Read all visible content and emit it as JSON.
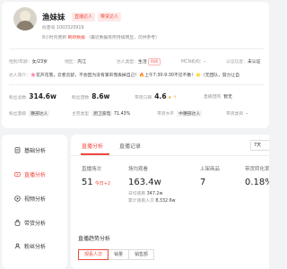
{
  "profile": {
    "name": "渔妹妹",
    "tags": [
      "直播达人",
      "带货达人"
    ],
    "meta_line": "抖音号 1003320919",
    "meta_line2_prefix": "8小时内更新",
    "meta_line2_link": "刷新数据",
    "meta_line2_suffix": "（最近数据有所持续明显，仅供参考）"
  },
  "info_row1": {
    "gender_label": "性别/年龄",
    "gender_value": "女/23岁",
    "region_label": "地区",
    "region_value": "内江",
    "type_label": "达人类型",
    "type_value": "生活",
    "type_pill": "时尚",
    "mcn_label": "MCN机构",
    "mcn_value": "-",
    "cert_label": "认证信息",
    "cert_value": "未认证"
  },
  "bio": {
    "label": "达人简介",
    "text": "🌸花开花落，云卷云舒，不会因为没有掌声而丢掉自己！🔥上午7:30-9:30不见不散！🌟（无团队，努力让自"
  },
  "stats_row1": {
    "fans_label": "粉丝总数",
    "fans_value": "314.6w",
    "fans_gain_label": "粉丝团数",
    "fans_gain_value": "8.6w",
    "score_label": "带货口碑",
    "score_value": "4.6",
    "score_star": "★",
    "score_rank": "↑",
    "level_label": "直播团购",
    "level_value": "暂无"
  },
  "stats_row2": {
    "level_label": "粉丝量级",
    "level_value": "腰部达人",
    "main_label": "主营类型",
    "main_value": "厨卫家电",
    "main_pct": "71.43%",
    "tier_label": "带货水平",
    "tier_value": "中腰部达人",
    "cat_label": "带货类目",
    "cat_value": "-"
  },
  "sidebar": {
    "items": [
      "基础分析",
      "直播分析",
      "视频分析",
      "带货分析",
      "粉丝分析"
    ]
  },
  "main": {
    "tabs": [
      "直播分析",
      "直播记录"
    ],
    "day_select": "7天",
    "metrics": [
      {
        "label": "直播场次",
        "value": "51",
        "delta": "今日+2"
      },
      {
        "label": "场均观看",
        "value": "163.4w",
        "sub1_label": "日均观看",
        "sub1_value": "347.2w",
        "sub2_label": "累计观看人次",
        "sub2_value": "8,332.6w"
      },
      {
        "label": "上架商品",
        "value": "7"
      },
      {
        "label": "带货转化率",
        "value": "0.18%"
      }
    ],
    "trend_title": "直播趋势分析",
    "trend_buttons": [
      "观看人次",
      "销量",
      "销售额"
    ]
  },
  "colors": {
    "accent": "#f04a3e",
    "background": "#f2f3f5"
  }
}
